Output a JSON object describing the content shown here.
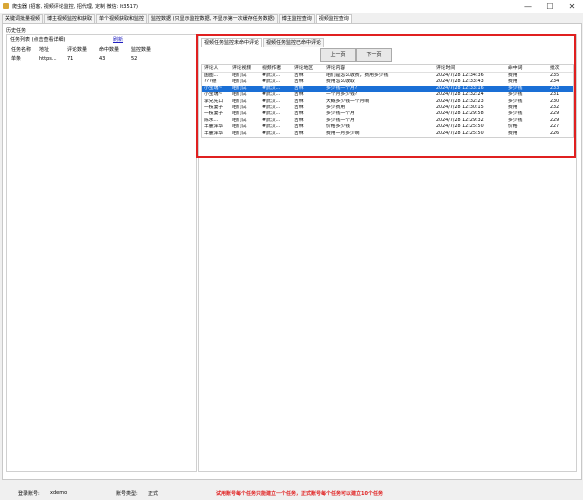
{
  "window": {
    "title": "爬虫器 (招客, 视频评论监控, 招代理, 定制 微信: lt3517)",
    "minimize": "—",
    "maximize": "☐",
    "close": "✕"
  },
  "tabs": [
    {
      "label": "关键词批量视频"
    },
    {
      "label": "博主视频监控和获取"
    },
    {
      "label": "单个视频获取和监控"
    },
    {
      "label": "监控数据 (只显示监控数据, 不显示第一次缓存任务数据)"
    },
    {
      "label": "博主监控查询"
    },
    {
      "label": "视频监控查询"
    }
  ],
  "history_label": "历史任务",
  "task_list": {
    "legend": "任务列表 (点击查看详细)",
    "refresh": "刷新",
    "columns": [
      "任务名称",
      "地址",
      "评论数量",
      "命中数量",
      "监控数量"
    ],
    "rows": [
      [
        "单条",
        "https...",
        "71",
        "43",
        "52"
      ]
    ]
  },
  "subtabs": [
    {
      "label": "视频任务监控未命中评论"
    },
    {
      "label": "视频任务监控已命中评论"
    }
  ],
  "nav": {
    "prev": "上一页",
    "next": "下一页"
  },
  "comments": {
    "columns": [
      "评论人",
      "评论视频",
      "视频作者",
      "评论地区",
      "评论内容",
      "评论时间",
      "命中词",
      "批次"
    ],
    "rows": [
      [
        "国图...",
        "咱们试",
        "#武汉...",
        "吉林",
        "咱们是怎么收费，费用多少钱",
        "2024/7/28 12:34:36",
        "费用",
        "235"
      ],
      [
        "???德",
        "咱们试",
        "#武汉...",
        "吉林",
        "费用怎么收取",
        "2024/7/28 12:33:43",
        "费用",
        "234"
      ],
      [
        "小宝瑞~",
        "咱们试",
        "#武汉...",
        "吉林",
        "多少钱一个月?",
        "2024/7/28 12:33:16",
        "多少钱",
        "233"
      ],
      [
        "小宝瑞~",
        "咱们试",
        "#武汉...",
        "吉林",
        "一个月多少钱?",
        "2024/7/28 12:32:24",
        "多少钱",
        "231"
      ],
      [
        "李兄先口",
        "咱们试",
        "#武汉...",
        "吉林",
        "大概多少钱一个月啊",
        "2024/7/28 12:32:23",
        "多少钱",
        "230"
      ],
      [
        "一枝妻子",
        "咱们试",
        "#武汉...",
        "吉林",
        "多少费用",
        "2024/7/28 12:30:15",
        "费用",
        "232"
      ],
      [
        "一枝妻子",
        "咱们试",
        "#武汉...",
        "吉林",
        "多少钱一个月",
        "2024/7/28 12:29:58",
        "多少钱",
        "229"
      ],
      [
        "陈水...",
        "咱们试",
        "#武汉...",
        "吉林",
        "多少钱一个月",
        "2024/7/28 12:29:32",
        "多少钱",
        "229"
      ],
      [
        "丰麓浑华",
        "咱们试",
        "#武汉...",
        "吉林",
        "价格多少钱",
        "2024/7/28 12:25:50",
        "价格",
        "227"
      ],
      [
        "丰麓浑华",
        "咱们试",
        "#武汉...",
        "吉林",
        "费用一月多少啊",
        "2024/7/28 12:25:50",
        "费用",
        "226"
      ]
    ],
    "selected_index": 2
  },
  "status": {
    "account_label": "登录账号:",
    "account_value": "xdemo",
    "type_label": "账号类型:",
    "type_value": "正式",
    "notice": "试用账号每个任务只能建立一个任务，正式账号每个任务可以建立10个任务"
  },
  "colors": {
    "highlight_frame": "#e02020",
    "selection": "#1a6fd6",
    "notice": "#e02020"
  }
}
